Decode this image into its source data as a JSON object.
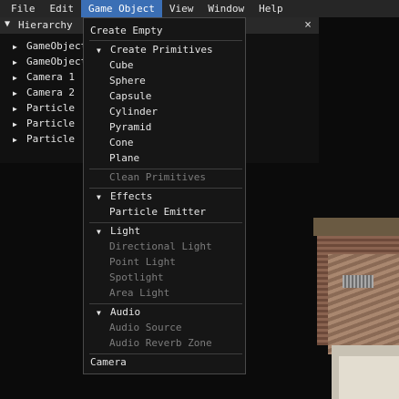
{
  "menubar": {
    "items": [
      "File",
      "Edit",
      "Game Object",
      "View",
      "Window",
      "Help"
    ],
    "active": "Game Object",
    "accent_color": "#3b6fb5"
  },
  "hierarchy": {
    "title": "Hierarchy",
    "close_icon": "×",
    "items": [
      "GameObject",
      "GameObject",
      "Camera 1",
      "Camera 2",
      "Particle",
      "Particle",
      "Particle"
    ]
  },
  "game_object_menu": {
    "create_empty": "Create Empty",
    "primitives": {
      "header": "Create Primitives",
      "items": [
        "Cube",
        "Sphere",
        "Capsule",
        "Cylinder",
        "Pyramid",
        "Cone",
        "Plane"
      ]
    },
    "clean_primitives": "Clean Primitives",
    "effects": {
      "header": "Effects",
      "items": [
        "Particle Emitter"
      ]
    },
    "light": {
      "header": "Light",
      "items": [
        "Directional Light",
        "Point Light",
        "Spotlight",
        "Area Light"
      ]
    },
    "audio": {
      "header": "Audio",
      "items": [
        "Audio Source",
        "Audio Reverb Zone"
      ]
    },
    "camera": "Camera",
    "disabled_color": "#7c7c7c"
  }
}
